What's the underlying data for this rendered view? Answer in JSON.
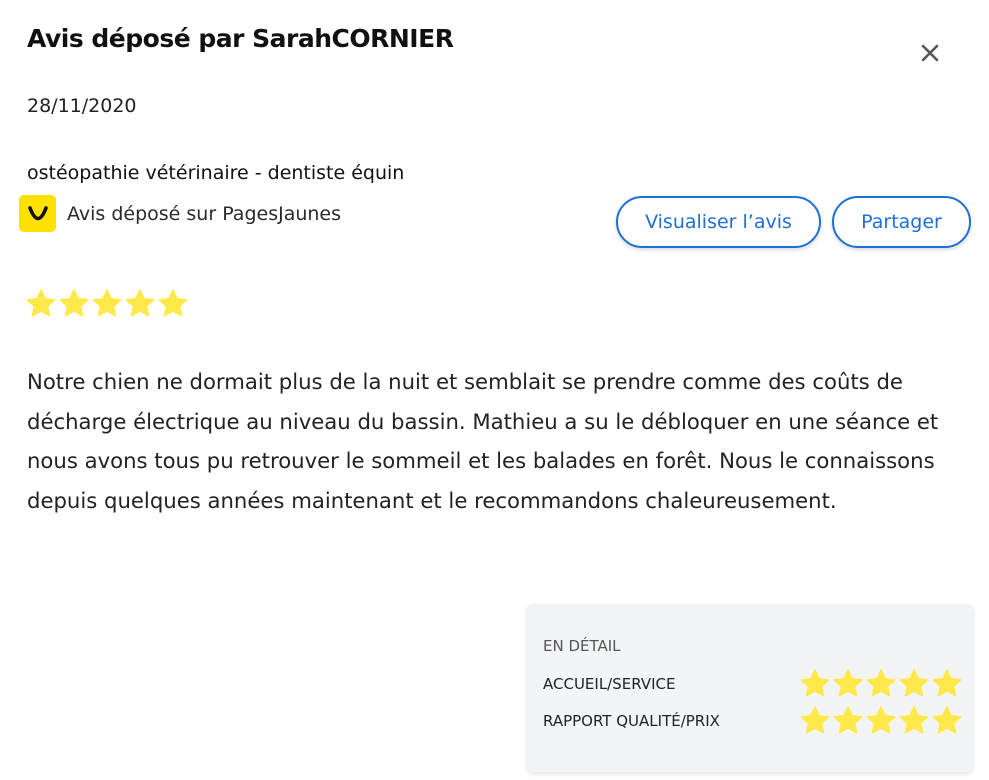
{
  "review": {
    "title": "Avis déposé par SarahCORNIER",
    "date": "28/11/2020",
    "category": "ostéopathie vétérinaire - dentiste équin",
    "source_text": "Avis déposé sur PagesJaunes",
    "rating": 5,
    "rating_max": 5,
    "text": "Notre chien ne dormait plus de la nuit et semblait se prendre comme des coûts de décharge électrique au niveau du bassin. Mathieu a su le débloquer en une séance et nous avons tous pu retrouver le sommeil et les balades en forêt. Nous le connaissons depuis quelques années maintenant et le recommandons chaleureusement."
  },
  "actions": {
    "view_label": "Visualiser l’avis",
    "share_label": "Partager"
  },
  "detail": {
    "heading": "EN DÉTAIL",
    "rows": [
      {
        "label": "ACCUEIL/SERVICE",
        "rating": 5
      },
      {
        "label": "RAPPORT QUALITÉ/PRIX",
        "rating": 5
      }
    ]
  },
  "colors": {
    "star": "#ffe84a",
    "accent": "#1f6fd6",
    "brand_yellow": "#ffe100",
    "detail_bg": "#f3f4f6"
  },
  "icons": {
    "close": "close-icon",
    "brand": "pagesjaunes-logo-icon",
    "rating": "star-icon"
  }
}
